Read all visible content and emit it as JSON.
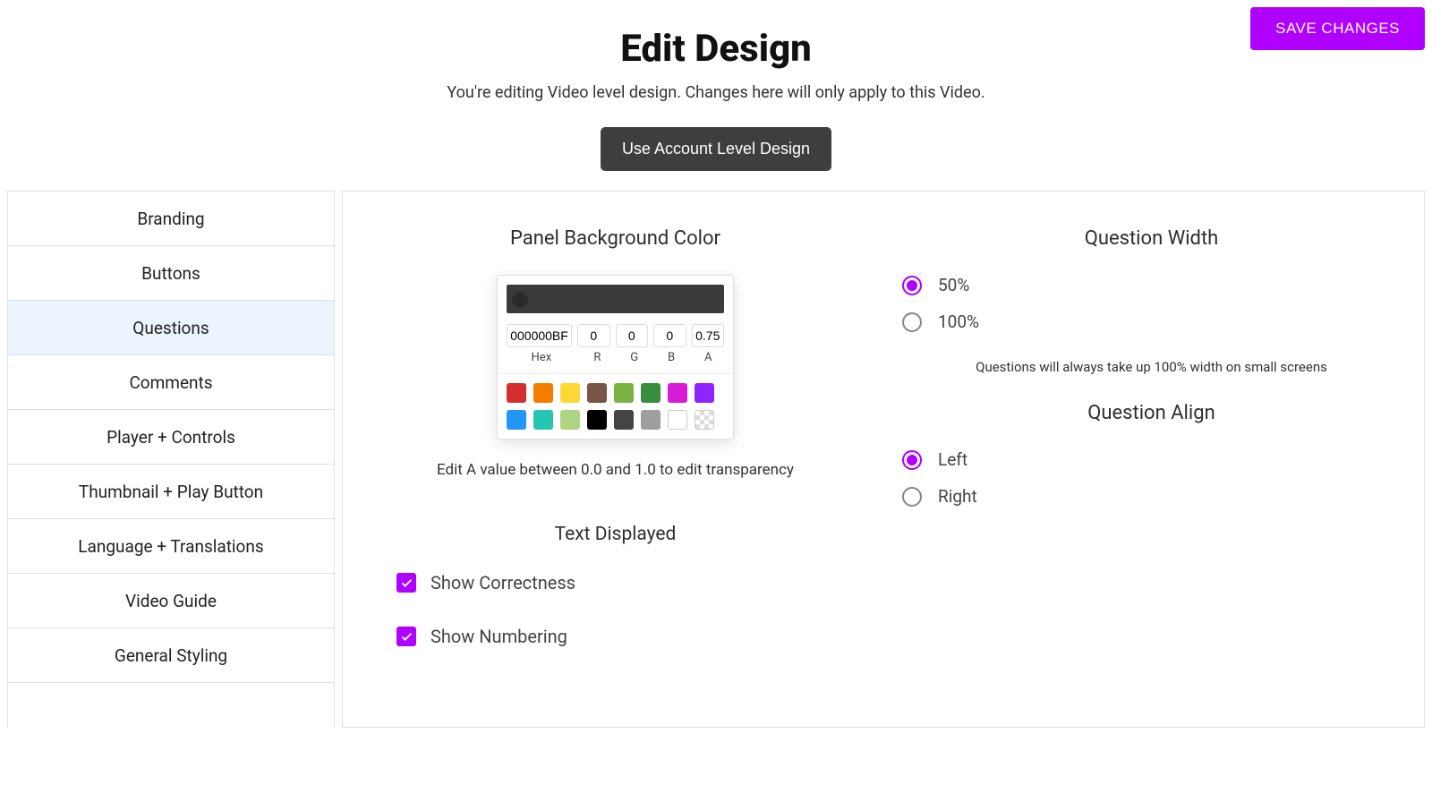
{
  "header": {
    "title": "Edit Design",
    "subtitle": "You're editing Video level design. Changes here will only apply to this Video.",
    "account_level_button": "Use Account Level Design",
    "save_button": "SAVE CHANGES"
  },
  "sidebar": {
    "items": [
      {
        "label": "Branding",
        "active": false
      },
      {
        "label": "Buttons",
        "active": false
      },
      {
        "label": "Questions",
        "active": true
      },
      {
        "label": "Comments",
        "active": false
      },
      {
        "label": "Player + Controls",
        "active": false
      },
      {
        "label": "Thumbnail + Play Button",
        "active": false
      },
      {
        "label": "Language + Translations",
        "active": false
      },
      {
        "label": "Video Guide",
        "active": false
      },
      {
        "label": "General Styling",
        "active": false
      }
    ]
  },
  "panel_bg": {
    "title": "Panel Background Color",
    "hex": "000000BF",
    "r": "0",
    "g": "0",
    "b": "0",
    "a": "0.75",
    "labels": {
      "hex": "Hex",
      "r": "R",
      "g": "G",
      "b": "B",
      "a": "A"
    },
    "swatches": [
      "#d32f2f",
      "#f57c00",
      "#fdd835",
      "#795548",
      "#7cb342",
      "#388e3c",
      "#d81bd8",
      "#8e24ff",
      "#2196f3",
      "#26c6b0",
      "#aed581",
      "#000000",
      "#444444",
      "#9e9e9e",
      "#ffffff",
      "checker"
    ],
    "hint": "Edit A value between 0.0 and 1.0 to edit transparency"
  },
  "text_displayed": {
    "title": "Text Displayed",
    "options": [
      {
        "label": "Show Correctness",
        "checked": true
      },
      {
        "label": "Show Numbering",
        "checked": true
      }
    ]
  },
  "question_width": {
    "title": "Question Width",
    "options": [
      {
        "label": "50%",
        "checked": true
      },
      {
        "label": "100%",
        "checked": false
      }
    ],
    "note": "Questions will always take up 100% width on small screens"
  },
  "question_align": {
    "title": "Question Align",
    "options": [
      {
        "label": "Left",
        "checked": true
      },
      {
        "label": "Right",
        "checked": false
      }
    ]
  },
  "colors": {
    "accent": "#b000ff"
  }
}
